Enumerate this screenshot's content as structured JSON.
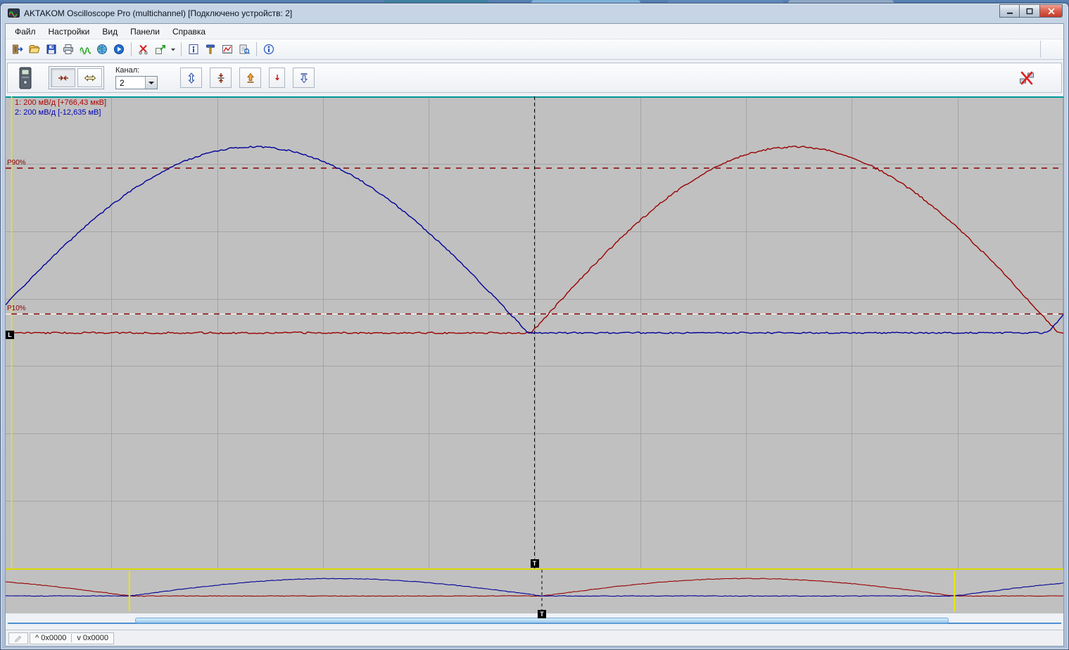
{
  "window": {
    "title": "AKTAKOM Oscilloscope Pro (multichannel) [Подключено устройств: 2]"
  },
  "menu": {
    "items": [
      {
        "id": "file",
        "label": "Файл"
      },
      {
        "id": "settings",
        "label": "Настройки"
      },
      {
        "id": "view",
        "label": "Вид"
      },
      {
        "id": "panels",
        "label": "Панели"
      },
      {
        "id": "help",
        "label": "Справка"
      }
    ]
  },
  "toolbar": {
    "groups": [
      {
        "icons": [
          "exit-icon",
          "open-icon",
          "save-icon",
          "print-icon",
          "waveform-icon",
          "web-icon",
          "run-icon"
        ]
      },
      {
        "icons": [
          "cut-icon",
          "export-icon",
          "export-dropdown-icon"
        ]
      },
      {
        "icons": [
          "info-panel-icon",
          "pin-icon",
          "measure-icon",
          "print-preview-icon"
        ]
      },
      {
        "icons": [
          "help-icon"
        ]
      }
    ]
  },
  "control_panel": {
    "channel_label": "Канал:",
    "channel_value": "2"
  },
  "scope": {
    "ch1_label": "1: 200 мВ/д [+766,43 мкВ]",
    "ch2_label": "2: 200 мВ/д [-12,635 мВ]",
    "trigger_marker": "T",
    "level_marker": "L"
  },
  "statusbar": {
    "up_value": "^ 0x0000",
    "down_value": "v 0x0000"
  },
  "scrollbar": {
    "thumb_start_frac": 0.121,
    "thumb_end_frac": 0.893
  },
  "colors": {
    "ch1": "#990000",
    "ch2": "#000099",
    "ch1_label": "#b00000",
    "ch2_label": "#0000b0",
    "plot_bg": "#c0c0c0",
    "grid": "#a4a4a4",
    "threshold": "#8b0000",
    "marker_yellow": "#e8e800",
    "top_line": "#009898"
  },
  "chart_data": {
    "type": "line",
    "title": "Oscilloscope traces: two 200 мВ/д channels, half-sine pulses in antiphase",
    "xlabel": "",
    "ylabel": "",
    "x_divisions": 10,
    "y_divisions": 7,
    "trigger_x_frac": 0.5,
    "left_marker_x_frac": 0.003,
    "series": [
      {
        "name": "CH1",
        "color": "#990000",
        "scale": "200 мВ/д",
        "offset_readout": "+766,43 мкВ",
        "baseline_frac": 0.501,
        "amplitude_frac": 0.394,
        "humps": [
          [
            0.497,
            0.995
          ]
        ]
      },
      {
        "name": "CH2",
        "color": "#000099",
        "scale": "200 мВ/д",
        "offset_readout": "-12,635 мВ",
        "baseline_frac": 0.501,
        "amplitude_frac": 0.394,
        "humps": [
          [
            -0.025,
            0.494
          ],
          [
            0.985,
            1.475
          ]
        ]
      }
    ],
    "thresholds": [
      {
        "label": "P90%",
        "y_frac": 0.152
      },
      {
        "label": "P10%",
        "y_frac": 0.461
      }
    ],
    "overview": {
      "baseline_frac": 0.6,
      "amplitude_frac": 0.4,
      "ch1_humps": [
        [
          -0.273,
          0.117
        ],
        [
          0.507,
          0.897
        ],
        [
          1.287,
          1.677
        ]
      ],
      "ch2_humps": [
        [
          0.117,
          0.507
        ],
        [
          0.897,
          1.287
        ]
      ],
      "window_start_frac": 0.117,
      "window_end_frac": 0.897,
      "trigger_x_frac": 0.507
    }
  }
}
